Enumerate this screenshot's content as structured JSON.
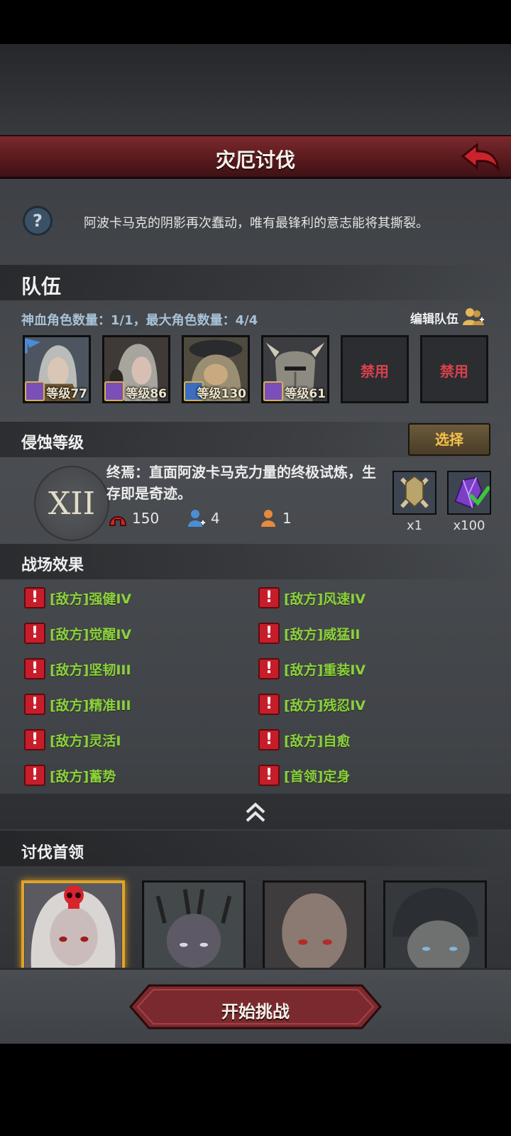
{
  "header": {
    "title": "灾厄讨伐",
    "back_icon": "back-arrow-icon"
  },
  "description": "阿波卡马克的阴影再次蠢动，唯有最锋利的意志能将其撕裂。",
  "team": {
    "title": "队伍",
    "count_text": "神血角色数量：1/1，最大角色数量：4/4",
    "edit_label": "编辑队伍",
    "slots": [
      {
        "level": "等级77",
        "portrait": "elf-female-hero"
      },
      {
        "level": "等级86",
        "portrait": "elf-female-grey-hair"
      },
      {
        "level": "等级130",
        "portrait": "fur-armored-warrior"
      },
      {
        "level": "等级61",
        "portrait": "horned-helmet-knight"
      },
      {
        "disabled_label": "禁用"
      },
      {
        "disabled_label": "禁用"
      }
    ]
  },
  "corruption": {
    "title": "侵蚀等级",
    "select_label": "选择",
    "level_numeral": "XII",
    "description": "终焉：直面阿波卡马克力量的终极试炼，生存即是奇迹。",
    "stats": {
      "helmet": "150",
      "team_size": "4",
      "other": "1"
    },
    "rewards": [
      {
        "icon": "crossed-axes-emblem-icon",
        "count": "x1"
      },
      {
        "icon": "purple-crystal-icon",
        "count": "x100",
        "checked": true
      }
    ]
  },
  "battlefield": {
    "title": "战场效果",
    "left": [
      "[敌方]强健IV",
      "[敌方]觉醒IV",
      "[敌方]坚韧III",
      "[敌方]精准III",
      "[敌方]灵活I",
      "[敌方]蓄势"
    ],
    "right": [
      "[敌方]风速IV",
      "[敌方]威猛II",
      "[敌方]重装IV",
      "[敌方]残忍IV",
      "[敌方]自愈",
      "[首领]定身"
    ]
  },
  "bosses": {
    "title": "讨伐首领",
    "items": [
      "pale-vampire-boss",
      "thorn-crowned-boss",
      "bald-scarred-boss",
      "dark-haired-brute-boss"
    ]
  },
  "start_button": "开始挑战",
  "colors": {
    "accent_red": "#7a2a2e",
    "effect_green": "#8cd13e",
    "warn_red": "#c71d2a",
    "gold": "#f4c24a"
  }
}
